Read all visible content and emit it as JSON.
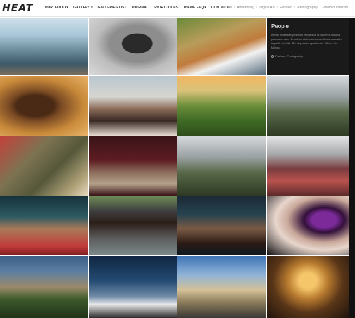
{
  "brand": {
    "logo": "HEAT"
  },
  "nav": [
    {
      "label": "PORTFOLIO ▾"
    },
    {
      "label": "GALLERY ▾"
    },
    {
      "label": "GALLERIES LIST"
    },
    {
      "label": "JOURNAL"
    },
    {
      "label": "SHORTCODES"
    },
    {
      "label": "THEME FAQ ▾"
    },
    {
      "label": "CONTACT"
    }
  ],
  "filters": [
    "All",
    "Advertising",
    "Digital Art",
    "Fashion",
    "Photography",
    "Photojournalism"
  ],
  "featured": {
    "title": "People",
    "text": "An vel deleniti expetenda efficiantur, ut docendi mucius platonem eum. Erroribus elaboraret mea. Malis quaestio impedit ad, tota. Pri at quando appellantur. Photo: Ivo Milosto",
    "tags": "Fashion, Photography"
  },
  "tiles": [
    {
      "name": "harbor-photo",
      "alt": "Harbor with boats"
    },
    {
      "name": "woman-bw-photo",
      "alt": "Woman portrait"
    },
    {
      "name": "guitar-photo",
      "alt": "Man with guitar"
    },
    {
      "name": "horse-photo",
      "alt": "Horse portrait"
    },
    {
      "name": "sunglasses-photo",
      "alt": "Woman with sunglasses"
    },
    {
      "name": "hills-photo",
      "alt": "Green hills"
    },
    {
      "name": "old-man-city-photo",
      "alt": "Old man in city"
    },
    {
      "name": "soldiers-photo",
      "alt": "Soldiers"
    },
    {
      "name": "woman-red-curtain-photo",
      "alt": "Woman in front of red curtain"
    },
    {
      "name": "suited-man-photo",
      "alt": "Suited man in field"
    },
    {
      "name": "redhead-photo",
      "alt": "Woman in red dress"
    },
    {
      "name": "glasses-man-photo",
      "alt": "Man with glasses"
    },
    {
      "name": "old-man-hat-photo",
      "alt": "Old man with hat"
    },
    {
      "name": "bearded-man-photo",
      "alt": "Bearded man"
    },
    {
      "name": "orchid-woman-photo",
      "alt": "Woman with orchid"
    },
    {
      "name": "mountains-photo",
      "alt": "Mountains"
    },
    {
      "name": "lighthouse-photo",
      "alt": "Lighthouse"
    },
    {
      "name": "road-photo",
      "alt": "Road"
    },
    {
      "name": "church-photo",
      "alt": "Church interior"
    }
  ]
}
